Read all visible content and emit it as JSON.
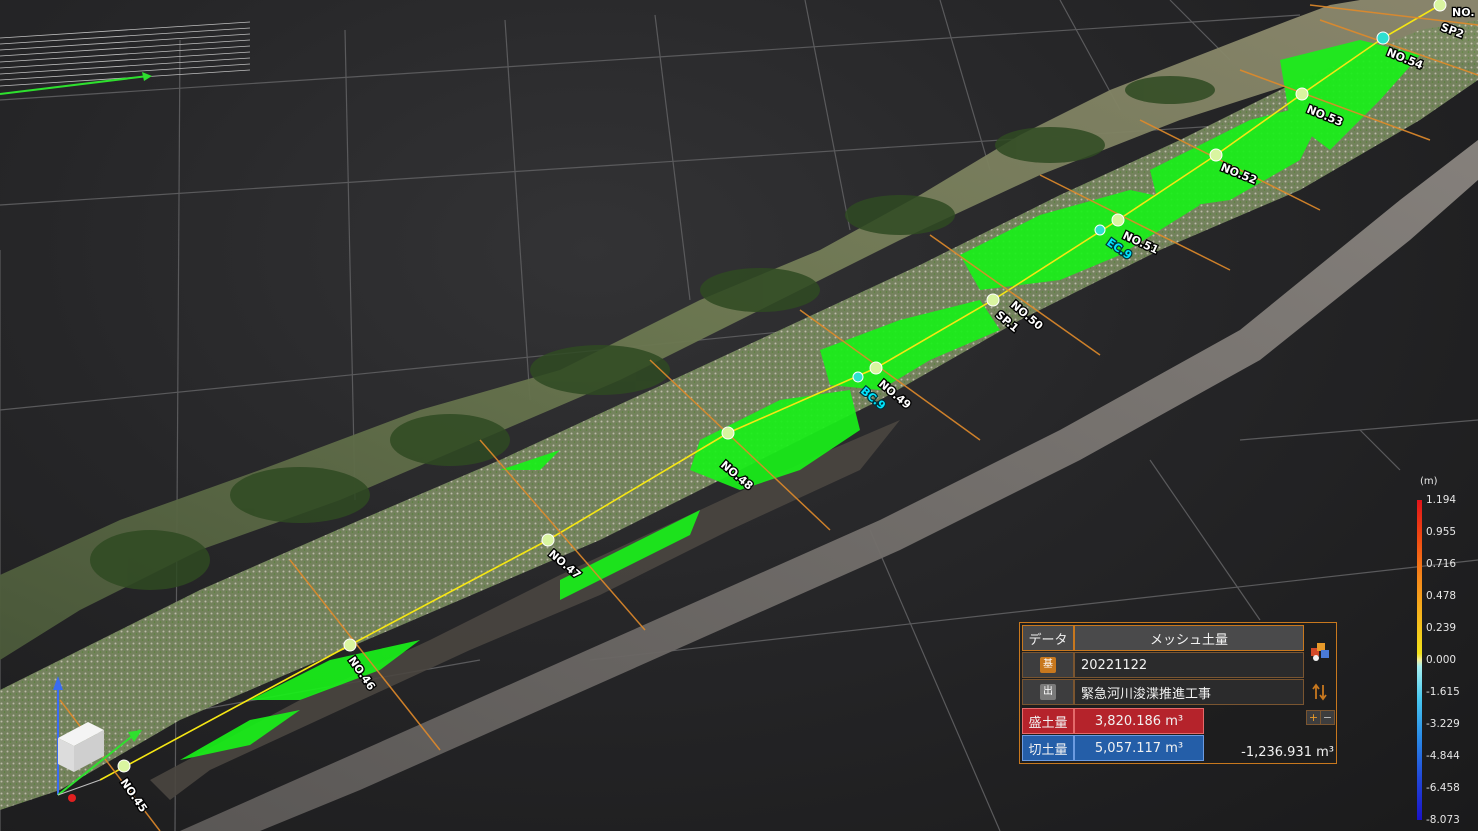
{
  "scene": {
    "stations": [
      "NO.45",
      "NO.46",
      "NO.47",
      "NO.48",
      "NO.49",
      "NO.50",
      "NO.51",
      "NO.52",
      "NO.53",
      "NO.54",
      "NO.",
      "SP2"
    ],
    "curve_points": [
      "BC.9",
      "SP.1",
      "EC.9"
    ],
    "colors": {
      "background": "#252527",
      "grid": "#5a5a5c",
      "centerline": "#f5e614",
      "cross_section": "#e08a2a",
      "fill_area": "#19f019",
      "station_marker": "#d9f5a0",
      "curve_marker": "#2ee0d0",
      "axis_x": "#2ee02e"
    }
  },
  "legend": {
    "unit": "(m)",
    "ticks": [
      "1.194",
      "0.955",
      "0.716",
      "0.478",
      "0.239",
      "0.000",
      "-1.615",
      "-3.229",
      "-4.844",
      "-6.458",
      "-8.073"
    ],
    "max_color": "#e0141a",
    "zero_color": "#f2f0a0",
    "min_color": "#1a12c8"
  },
  "panel": {
    "header_data": "データ",
    "header_type": "メッシュ土量",
    "base_tag": "基",
    "base_value": "20221122",
    "compare_tag": "出",
    "compare_value": "緊急河川浚渫推進工事",
    "fill_label": "盛土量",
    "fill_value": "3,820.186 m³",
    "cut_label": "切土量",
    "cut_value": "5,057.117 m³",
    "net_value": "-1,236.931 m³",
    "colors": {
      "fill": "#b5232b",
      "cut": "#245ea8",
      "border": "#c8781e"
    },
    "icons": [
      "layers-icon",
      "swap-icon",
      "plus-icon",
      "minus-icon"
    ]
  }
}
